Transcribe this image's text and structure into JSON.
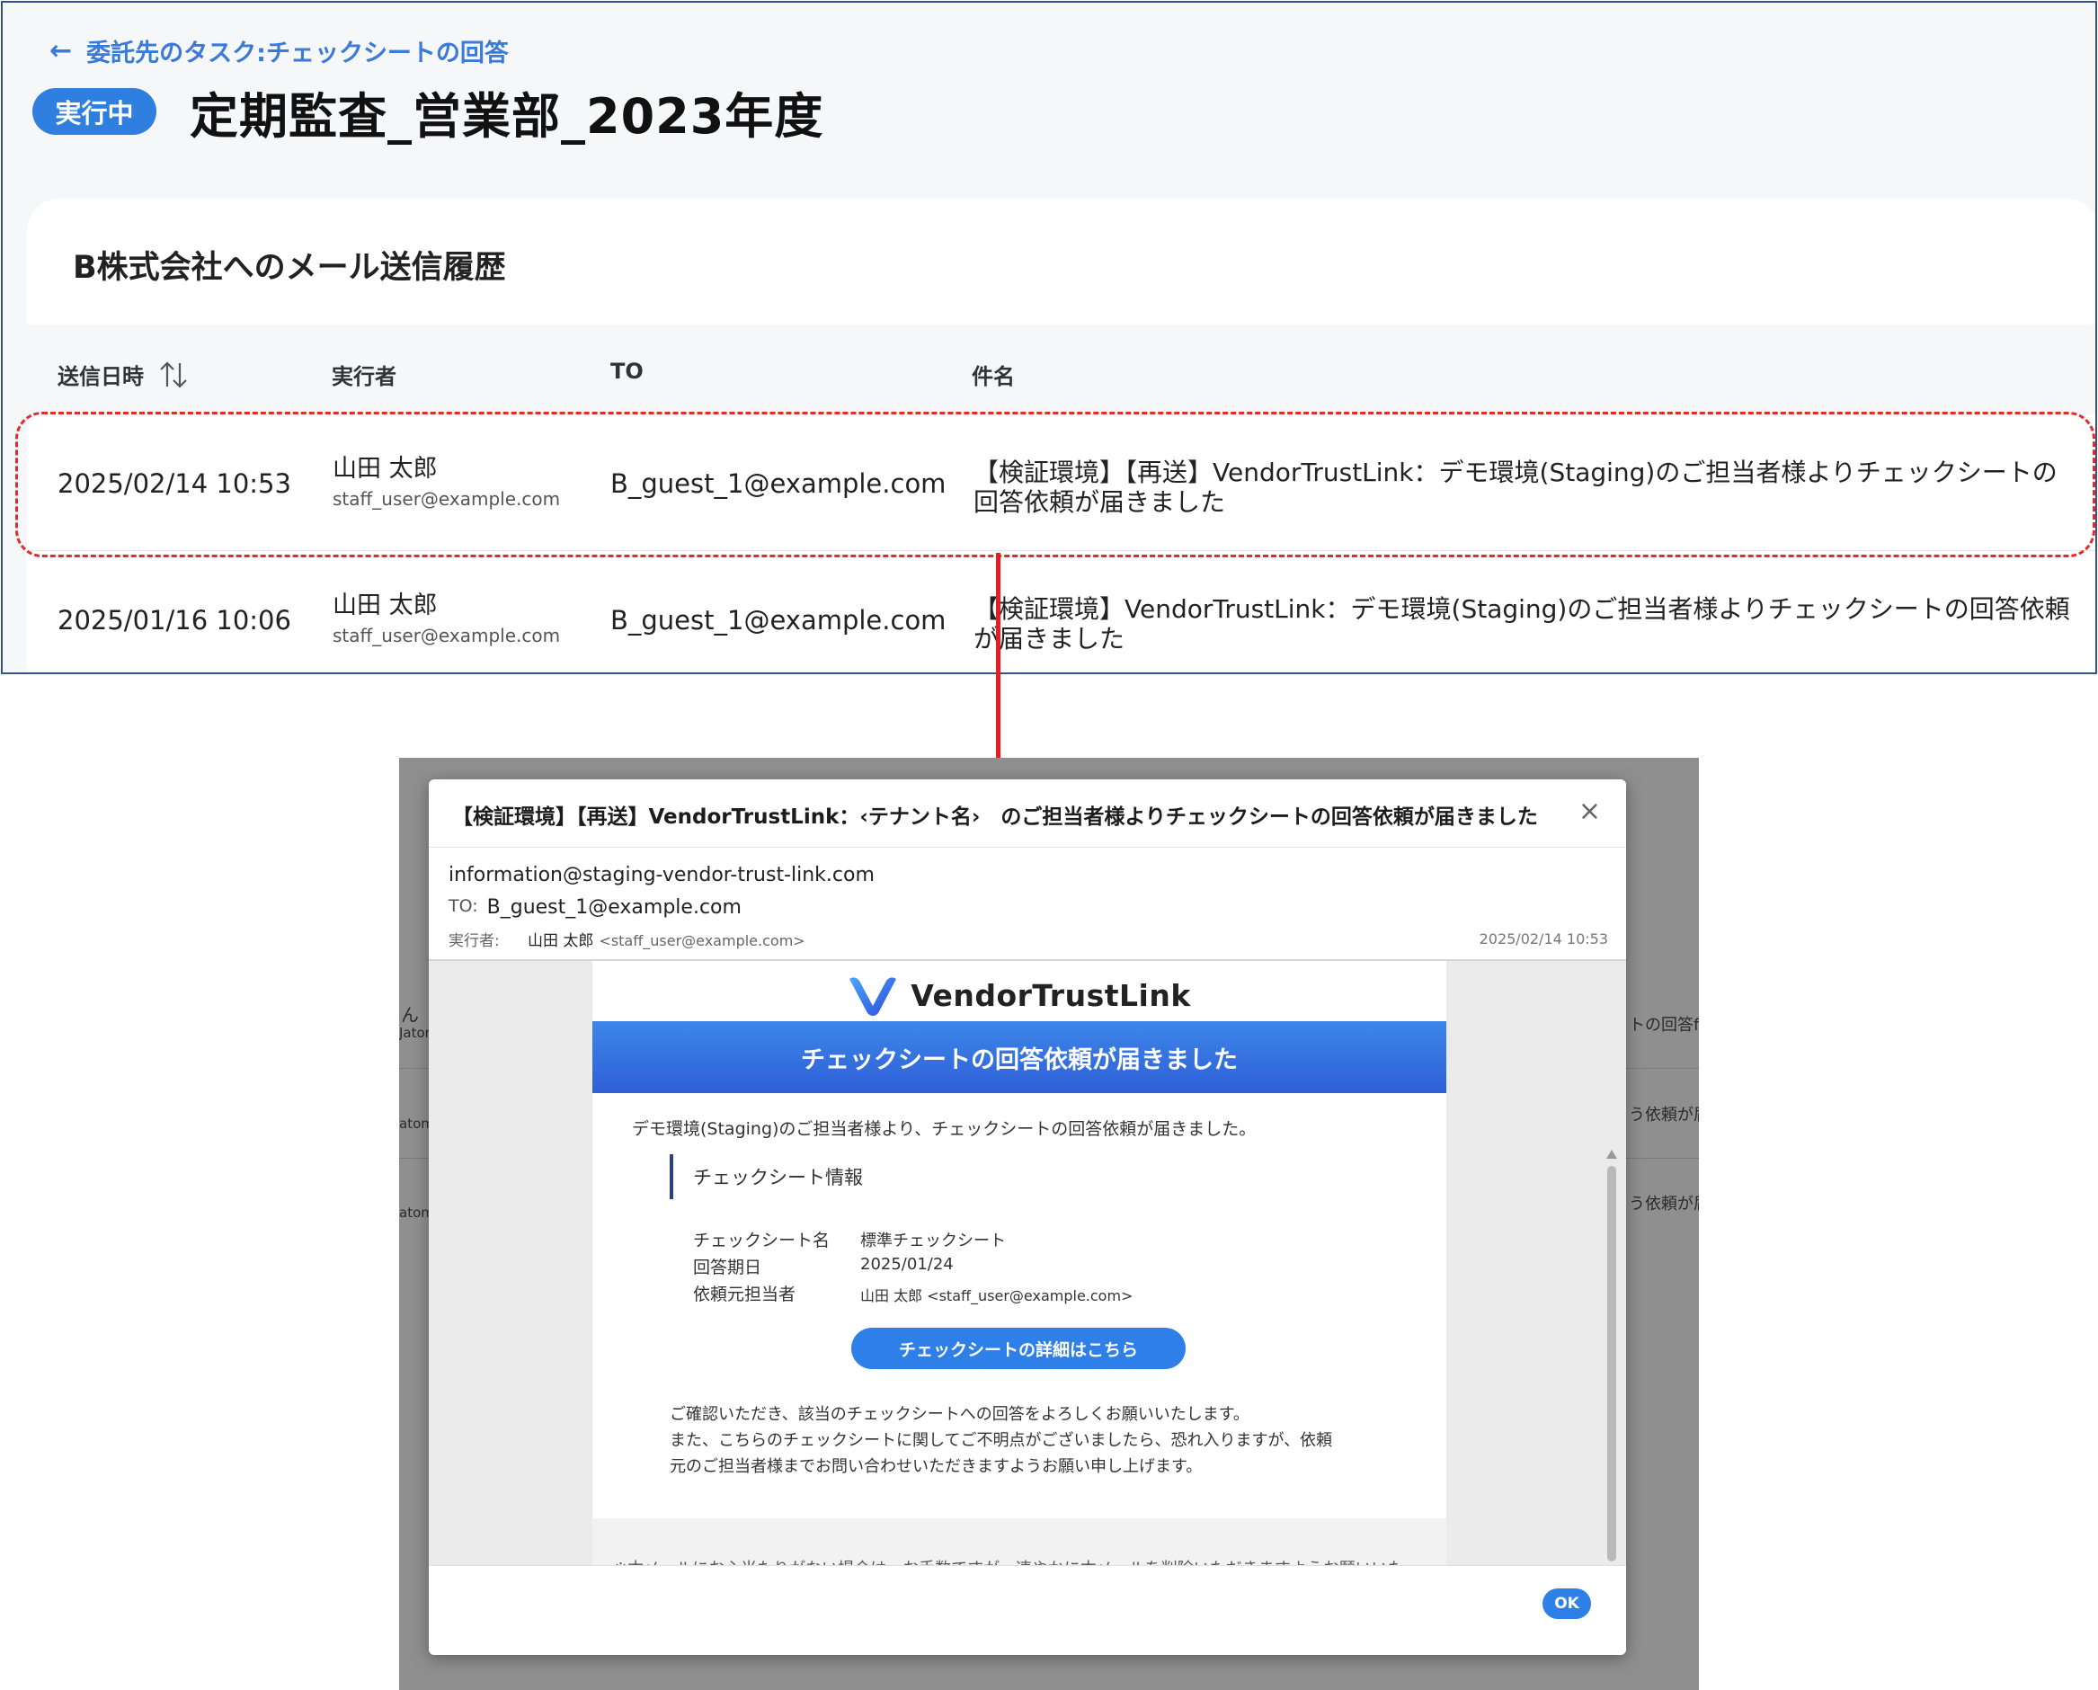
{
  "top": {
    "back_link": "委託先のタスク:チェックシートの回答",
    "status_badge": "実行中",
    "page_title": "定期監査_営業部_2023年度",
    "card_title": "B株式会社へのメール送信履歴",
    "columns": {
      "date": "送信日時",
      "executor": "実行者",
      "to": "TO",
      "subject": "件名"
    },
    "rows": [
      {
        "date": "2025/02/14 10:53",
        "executor_name": "山田 太郎",
        "executor_email": "staff_user@example.com",
        "to": "B_guest_1@example.com",
        "subject": "【検証環境】【再送】VendorTrustLink：デモ環境(Staging)のご担当者様よりチェックシートの回答依頼が届きました"
      },
      {
        "date": "2025/01/16 10:06",
        "executor_name": "山田 太郎",
        "executor_email": "staff_user@example.com",
        "to": "B_guest_1@example.com",
        "subject": "【検証環境】VendorTrustLink：デモ環境(Staging)のご担当者様よりチェックシートの回答依頼が届きました"
      }
    ]
  },
  "background_fragments": [
    "ん",
    "Jator",
    "atom",
    "atom",
    "トの回答f",
    "う依頼が届",
    "う依頼が届"
  ],
  "modal": {
    "subject": "【検証環境】【再送】VendorTrustLink：‹テナント名›　のご担当者様よりチェックシートの回答依頼が届きました",
    "close_icon": "×",
    "from": "information@staging-vendor-trust-link.com",
    "to_label": "TO:",
    "to_value": "B_guest_1@example.com",
    "executor_label": "実行者:",
    "executor_name": "山田 太郎",
    "executor_email": "<staff_user@example.com>",
    "date": "2025/02/14 10:53",
    "ok_label": "OK"
  },
  "mail": {
    "brand_name": "VendorTrustLink",
    "banner": "チェックシートの回答依頼が届きました",
    "intro": "デモ環境(Staging)のご担当者様より、チェックシートの回答依頼が届きました。",
    "info_heading": "チェックシート情報",
    "info": [
      {
        "key": "チェックシート名",
        "value": "標準チェックシート"
      },
      {
        "key": "回答期日",
        "value": "2025/01/24"
      },
      {
        "key": "依頼元担当者",
        "value": "山田 太郎 <staff_user@example.com>"
      }
    ],
    "cta_label": "チェックシートの詳細はこちら",
    "outro": [
      "ご確認いただき、該当のチェックシートへの回答をよろしくお願いいたします。",
      "また、こちらのチェックシートに関してご不明点がございましたら、恐れ入りますが、依頼",
      "元のご担当者様までお問い合わせいただきますようお願い申し上げます。"
    ],
    "footer_cut": "※本メールにお心当たりがない場合は、お手数ですが、速やかに本メールを削除いただきますようお願いいた"
  },
  "colors": {
    "accent": "#2f7fe0",
    "highlight": "#e32b2b",
    "panel_border": "#31538f"
  }
}
